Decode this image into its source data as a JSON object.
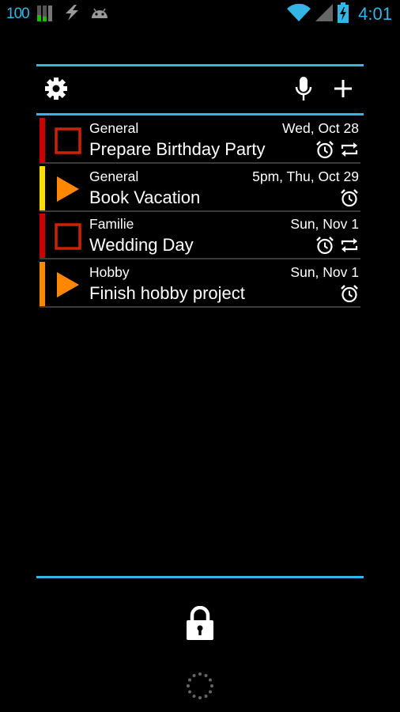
{
  "status_bar": {
    "battery_percent": "100",
    "time": "4:01",
    "icons": [
      "signal-bars-icon",
      "usb-debug-icon",
      "android-icon",
      "wifi-icon",
      "cell-signal-icon",
      "battery-charging-icon"
    ]
  },
  "toolbar": {
    "icons": [
      "gear-icon",
      "microphone-icon",
      "plus-icon"
    ]
  },
  "tasks": [
    {
      "category": "General",
      "title": "Prepare Birthday Party",
      "due": "Wed, Oct 28",
      "priority_color": "#cc0000",
      "status": "checkbox",
      "alarm": true,
      "repeat": true
    },
    {
      "category": "General",
      "title": "Book Vacation",
      "due": "5pm, Thu, Oct 29",
      "priority_color": "#ffdd00",
      "status": "play",
      "alarm": true,
      "repeat": false
    },
    {
      "category": "Familie",
      "title": "Wedding Day",
      "due": "Sun, Nov 1",
      "priority_color": "#cc0000",
      "status": "checkbox",
      "alarm": true,
      "repeat": true
    },
    {
      "category": "Hobby",
      "title": "Finish hobby project",
      "due": "Sun, Nov 1",
      "priority_color": "#ff8800",
      "status": "play",
      "alarm": true,
      "repeat": false
    }
  ],
  "colors": {
    "accent": "#33b5e5",
    "checkbox_border": "#cc2200",
    "play_arrow": "#ff8800",
    "row_divider": "#3a3a3a"
  },
  "lock": {
    "icons": [
      "lock-icon",
      "loading-spinner-icon"
    ]
  }
}
